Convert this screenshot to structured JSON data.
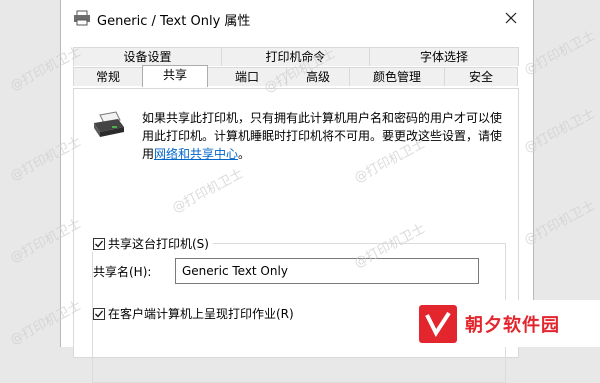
{
  "window": {
    "title": "Generic / Text Only 属性",
    "close_icon": "close-icon"
  },
  "tabs": {
    "row1": [
      "设备设置",
      "打印机命令",
      "字体选择"
    ],
    "row2": [
      "常规",
      "共享",
      "端口",
      "高级",
      "颜色管理",
      "安全"
    ],
    "active": "共享"
  },
  "sharing": {
    "description": "如果共享此打印机，只有拥有此计算机用户名和密码的用户才可以使用此打印机。计算机睡眠时打印机将不可用。要更改这些设置，请使用",
    "link_text": "网络和共享中心",
    "link_suffix": "。",
    "share_checkbox_label": "共享这台打印机(S)",
    "share_checked": true,
    "share_name_label": "共享名(H):",
    "share_name_value": "Generic  Text Only",
    "render_checkbox_label": "在客户端计算机上呈现打印作业(R)",
    "render_checked": true
  },
  "watermark": {
    "text": "@打印机卫士"
  },
  "brand": {
    "text": "朝夕软件园",
    "color": "#e3262d"
  }
}
